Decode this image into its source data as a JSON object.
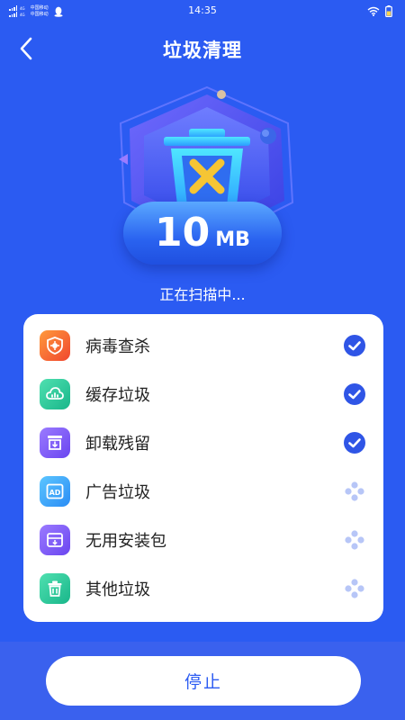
{
  "status_bar": {
    "time": "14:35",
    "network_1": "4G",
    "network_2": "4G",
    "carrier_1": "中国移动",
    "carrier_2": "中国移动"
  },
  "header": {
    "title": "垃圾清理",
    "back_icon": "chevron-left-icon"
  },
  "hero": {
    "size_value": "10",
    "size_unit": "MB",
    "scan_status": "正在扫描中..."
  },
  "scan_items": [
    {
      "label": "病毒查杀",
      "icon": "virus-shield-icon",
      "status": "done",
      "color_from": "#ff9a3c",
      "color_to": "#f0462f"
    },
    {
      "label": "缓存垃圾",
      "icon": "cloud-cache-icon",
      "status": "done",
      "color_from": "#4fe0b0",
      "color_to": "#19b68a"
    },
    {
      "label": "卸载残留",
      "icon": "uninstall-icon",
      "status": "done",
      "color_from": "#9b7bff",
      "color_to": "#6a45f0"
    },
    {
      "label": "广告垃圾",
      "icon": "ad-icon",
      "status": "scanning",
      "color_from": "#5cc6ff",
      "color_to": "#2a8cf5"
    },
    {
      "label": "无用安装包",
      "icon": "package-icon",
      "status": "scanning",
      "color_from": "#9b7bff",
      "color_to": "#6a45f0"
    },
    {
      "label": "其他垃圾",
      "icon": "trash-icon",
      "status": "scanning",
      "color_from": "#4fe0b0",
      "color_to": "#19b68a"
    }
  ],
  "footer": {
    "stop_label": "停止"
  },
  "colors": {
    "background": "#2b5bf2",
    "accent": "#2b5bf2",
    "done_check": "#2f55e6",
    "pending_dots": "#b7c6f7"
  }
}
